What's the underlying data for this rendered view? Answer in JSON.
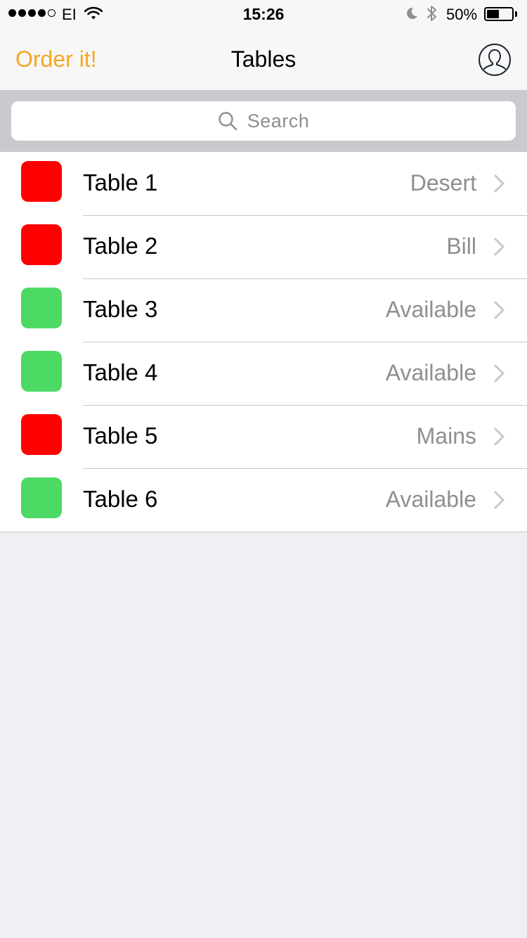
{
  "status_bar": {
    "carrier": "EI",
    "time": "15:26",
    "battery_percent": "50%",
    "battery_level": 0.5,
    "signal_bars_filled": 4,
    "signal_bars_total": 5
  },
  "nav": {
    "left_label": "Order it!",
    "title": "Tables",
    "right_icon": "profile-icon"
  },
  "search": {
    "placeholder": "Search"
  },
  "colors": {
    "accent": "#f5a623",
    "occupied": "#ff0000",
    "available": "#4cd964"
  },
  "tables": [
    {
      "name": "Table 1",
      "status": "Desert",
      "color": "#ff0000"
    },
    {
      "name": "Table 2",
      "status": "Bill",
      "color": "#ff0000"
    },
    {
      "name": "Table 3",
      "status": "Available",
      "color": "#4cd964"
    },
    {
      "name": "Table 4",
      "status": "Available",
      "color": "#4cd964"
    },
    {
      "name": "Table 5",
      "status": "Mains",
      "color": "#ff0000"
    },
    {
      "name": "Table 6",
      "status": "Available",
      "color": "#4cd964"
    }
  ]
}
